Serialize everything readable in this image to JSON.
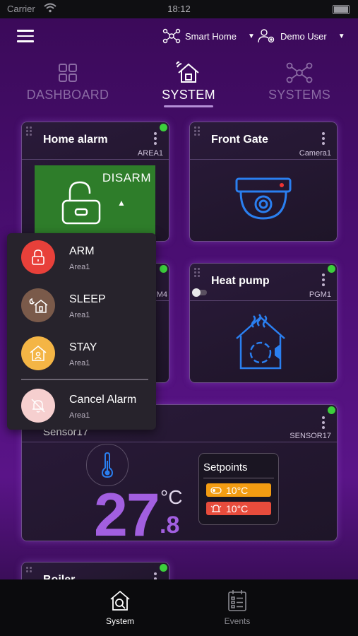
{
  "status": {
    "carrier": "Carrier",
    "time": "18:12"
  },
  "topbar": {
    "site": "Smart Home",
    "user": "Demo User"
  },
  "tabs": [
    {
      "label": "DASHBOARD",
      "active": false
    },
    {
      "label": "SYSTEM",
      "active": true
    },
    {
      "label": "SYSTEMS",
      "active": false
    }
  ],
  "cards": {
    "home_alarm": {
      "title": "Home alarm",
      "sub": "AREA1",
      "state": "DISARM"
    },
    "front_gate": {
      "title": "Front Gate",
      "sub": "Camera1"
    },
    "partial_card": {
      "sub": "M4"
    },
    "heat_pump": {
      "title": "Heat pump",
      "sub": "PGM1"
    },
    "sensor": {
      "title": "Sensor17",
      "sub": "SENSOR17",
      "temp_int": "27",
      "temp_dec": ".8",
      "unit": "°C",
      "setpoints_title": "Setpoints",
      "setpoint_high": "10°C",
      "setpoint_low": "10°C"
    },
    "boiler": {
      "title": "Boiler"
    }
  },
  "popup": [
    {
      "label": "ARM",
      "area": "Area1",
      "color": "#e8403a",
      "icon": "lock-icon"
    },
    {
      "label": "SLEEP",
      "area": "Area1",
      "color": "#7a5a4a",
      "icon": "sleep-house-icon"
    },
    {
      "label": "STAY",
      "area": "Area1",
      "color": "#f4b545",
      "icon": "stay-house-icon"
    },
    {
      "label": "Cancel Alarm",
      "area": "Area1",
      "color": "#f6cfcf",
      "icon": "bell-off-icon"
    }
  ],
  "nav": [
    {
      "label": "System",
      "active": true
    },
    {
      "label": "Events",
      "active": false
    }
  ],
  "colors": {
    "accent": "#a25fe0",
    "online": "#3ccf3c",
    "disarm": "#2e7d2a",
    "setpoint_high": "#f39c12",
    "setpoint_low": "#e74c3c"
  }
}
